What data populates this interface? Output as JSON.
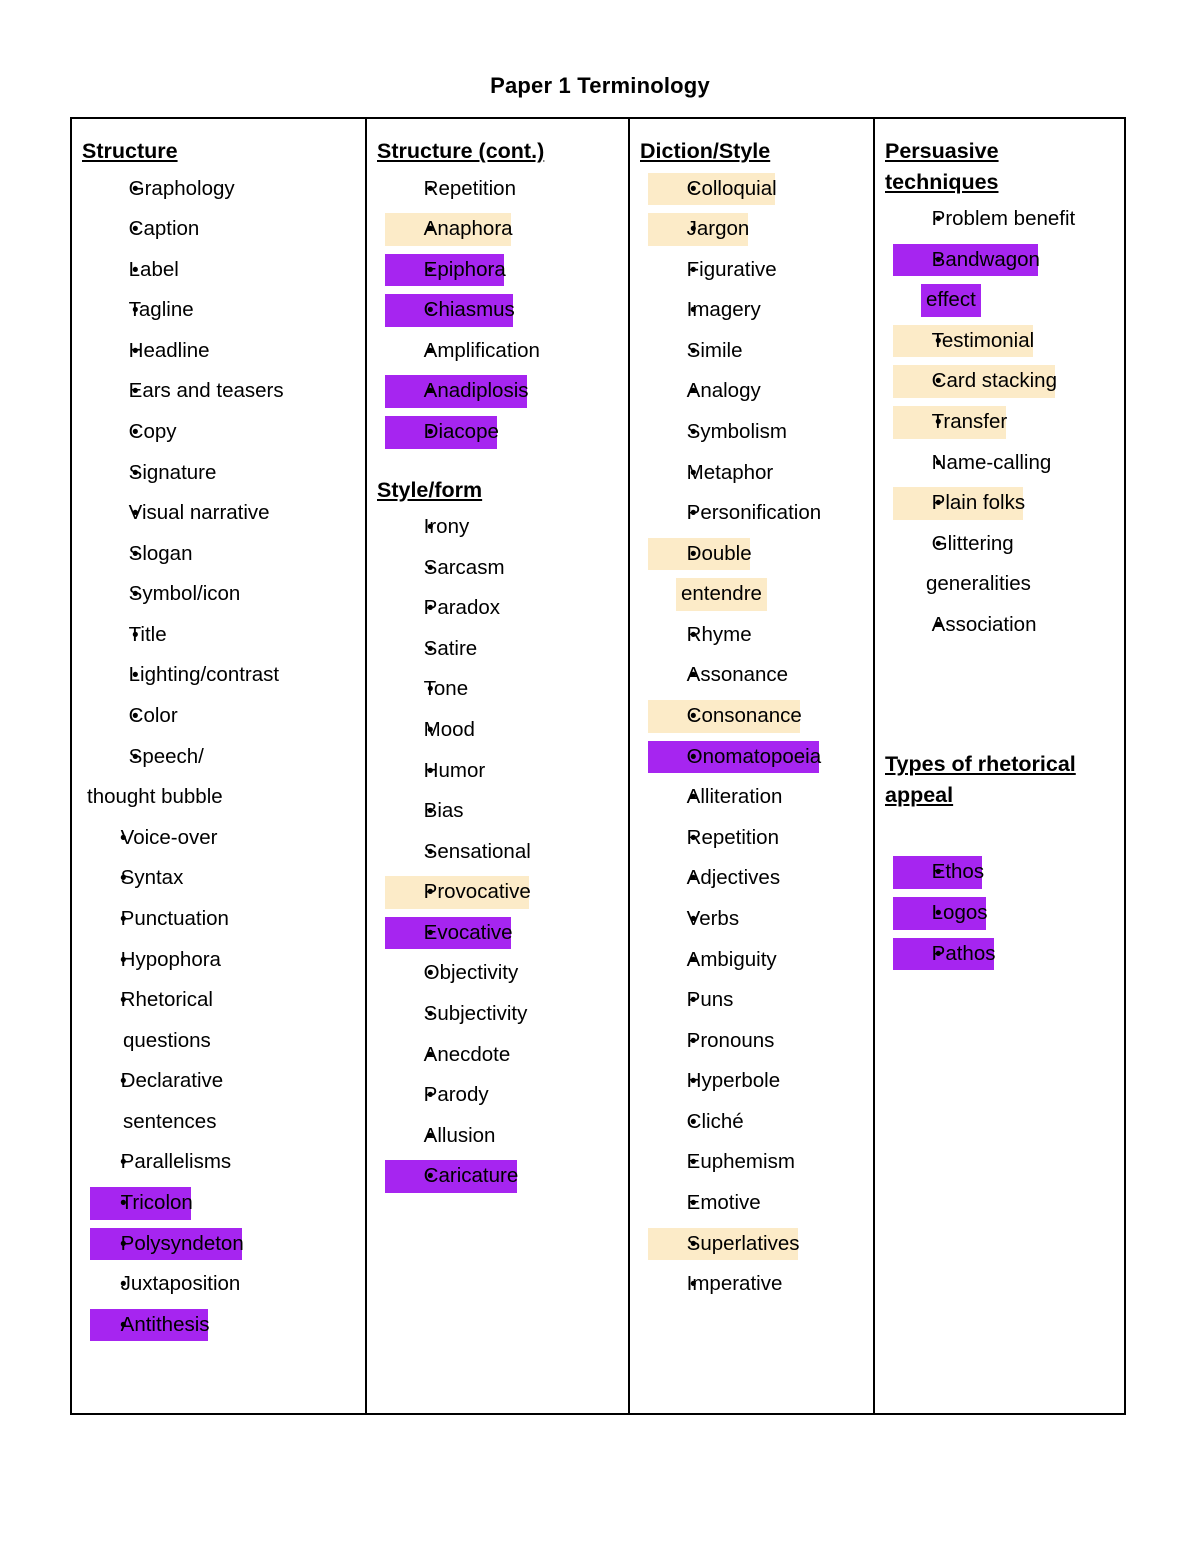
{
  "document": {
    "title": "Paper 1 Terminology",
    "highlight_colors": {
      "purple": "#a625f0",
      "cream": "#fcebc8",
      "none": "#ffffff"
    },
    "bullet_glyph": "•"
  },
  "columns": [
    {
      "id": "column-structure",
      "heading_lines": [
        "Structure"
      ],
      "items": [
        {
          "label": "Graphology",
          "highlight": "none"
        },
        {
          "label": "Caption",
          "highlight": "none"
        },
        {
          "label": "Label",
          "highlight": "none"
        },
        {
          "label": "Tagline",
          "highlight": "none"
        },
        {
          "label": "Headline",
          "highlight": "none"
        },
        {
          "label": "Ears and teasers",
          "highlight": "none"
        },
        {
          "label": "Copy",
          "highlight": "none"
        },
        {
          "label": "Signature",
          "highlight": "none"
        },
        {
          "label": "Visual narrative",
          "highlight": "none"
        },
        {
          "label": "Slogan",
          "highlight": "none"
        },
        {
          "label": "Symbol/icon",
          "highlight": "none"
        },
        {
          "label": "Title",
          "highlight": "none"
        },
        {
          "label": "Lighting/contrast",
          "highlight": "none"
        },
        {
          "label": "Color",
          "highlight": "none"
        },
        {
          "label": "Speech/",
          "highlight": "none",
          "continuation": "thought bubble",
          "continuation_style": "flush"
        },
        {
          "label": "Voice-over",
          "highlight": "none",
          "tight": true
        },
        {
          "label": "Syntax",
          "highlight": "none",
          "tight": true
        },
        {
          "label": "Punctuation",
          "highlight": "none",
          "tight": true
        },
        {
          "label": "Hypophora",
          "highlight": "none",
          "tight": true
        },
        {
          "label": "Rhetorical",
          "highlight": "none",
          "tight": true,
          "continuation": "questions",
          "continuation_style": "indent"
        },
        {
          "label": "Declarative",
          "highlight": "none",
          "tight": true,
          "continuation": "sentences",
          "continuation_style": "indent"
        },
        {
          "label": "Parallelisms",
          "highlight": "none",
          "tight": true
        },
        {
          "label": "Tricolon",
          "highlight": "purple",
          "tight": true
        },
        {
          "label": "Polysyndeton",
          "highlight": "purple",
          "tight": true
        },
        {
          "label": "Juxtaposition",
          "highlight": "none",
          "tight": true
        },
        {
          "label": "Antithesis",
          "highlight": "purple",
          "tight": true
        }
      ]
    },
    {
      "id": "column-structure-cont",
      "heading_lines": [
        "Structure (cont.)"
      ],
      "items": [
        {
          "label": "Repetition",
          "highlight": "none"
        },
        {
          "label": "Anaphora",
          "highlight": "cream"
        },
        {
          "label": "Epiphora",
          "highlight": "purple"
        },
        {
          "label": "Chiasmus",
          "highlight": "purple"
        },
        {
          "label": "Amplification",
          "highlight": "none"
        },
        {
          "label": "Anadiplosis",
          "highlight": "purple"
        },
        {
          "label": "Diacope",
          "highlight": "purple"
        }
      ],
      "subsections": [
        {
          "id": "subsection-style-form",
          "heading_lines": [
            "Style/form"
          ],
          "items": [
            {
              "label": "Irony",
              "highlight": "none"
            },
            {
              "label": "Sarcasm",
              "highlight": "none"
            },
            {
              "label": "Paradox",
              "highlight": "none"
            },
            {
              "label": "Satire",
              "highlight": "none"
            },
            {
              "label": "Tone",
              "highlight": "none"
            },
            {
              "label": "Mood",
              "highlight": "none"
            },
            {
              "label": "Humor",
              "highlight": "none"
            },
            {
              "label": "Bias",
              "highlight": "none"
            },
            {
              "label": "Sensational",
              "highlight": "none"
            },
            {
              "label": "Provocative",
              "highlight": "cream"
            },
            {
              "label": "Evocative",
              "highlight": "purple"
            },
            {
              "label": "Objectivity",
              "highlight": "none"
            },
            {
              "label": "Subjectivity",
              "highlight": "none"
            },
            {
              "label": "Anecdote",
              "highlight": "none"
            },
            {
              "label": "Parody",
              "highlight": "none"
            },
            {
              "label": "Allusion",
              "highlight": "none"
            },
            {
              "label": "Caricature",
              "highlight": "purple"
            }
          ]
        }
      ]
    },
    {
      "id": "column-diction-style",
      "heading_lines": [
        "Diction/Style"
      ],
      "items": [
        {
          "label": "Colloquial",
          "highlight": "cream"
        },
        {
          "label": "Jargon",
          "highlight": "cream"
        },
        {
          "label": "Figurative",
          "highlight": "none"
        },
        {
          "label": "Imagery",
          "highlight": "none"
        },
        {
          "label": "Simile",
          "highlight": "none"
        },
        {
          "label": "Analogy",
          "highlight": "none"
        },
        {
          "label": "Symbolism",
          "highlight": "none"
        },
        {
          "label": "Metaphor",
          "highlight": "none"
        },
        {
          "label": "Personification",
          "highlight": "none"
        },
        {
          "label": "Double",
          "highlight": "cream",
          "continuation": "entendre",
          "continuation_style": "indent"
        },
        {
          "label": "Rhyme",
          "highlight": "none"
        },
        {
          "label": "Assonance",
          "highlight": "none"
        },
        {
          "label": "Consonance",
          "highlight": "cream"
        },
        {
          "label": "Onomatopoeia",
          "highlight": "purple"
        },
        {
          "label": "Alliteration",
          "highlight": "none"
        },
        {
          "label": "Repetition",
          "highlight": "none"
        },
        {
          "label": "Adjectives",
          "highlight": "none"
        },
        {
          "label": "Verbs",
          "highlight": "none"
        },
        {
          "label": "Ambiguity",
          "highlight": "none"
        },
        {
          "label": "Puns",
          "highlight": "none"
        },
        {
          "label": "Pronouns",
          "highlight": "none"
        },
        {
          "label": "Hyperbole",
          "highlight": "none"
        },
        {
          "label": "Cliché",
          "highlight": "none"
        },
        {
          "label": "Euphemism",
          "highlight": "none"
        },
        {
          "label": "Emotive",
          "highlight": "none"
        },
        {
          "label": "Superlatives",
          "highlight": "cream"
        },
        {
          "label": "Imperative",
          "highlight": "none"
        }
      ]
    },
    {
      "id": "column-persuasive-techniques",
      "heading_lines": [
        "Persuasive",
        "techniques"
      ],
      "items": [
        {
          "label": "Problem benefit",
          "highlight": "none"
        },
        {
          "label": "Bandwagon",
          "highlight": "purple",
          "continuation": "effect",
          "continuation_style": "indent"
        },
        {
          "label": "Testimonial",
          "highlight": "cream"
        },
        {
          "label": "Card stacking",
          "highlight": "cream"
        },
        {
          "label": "Transfer",
          "highlight": "cream"
        },
        {
          "label": "Name-calling",
          "highlight": "none"
        },
        {
          "label": "Plain folks",
          "highlight": "cream"
        },
        {
          "label": "Glittering",
          "highlight": "none",
          "continuation": "generalities",
          "continuation_style": "indent"
        },
        {
          "label": "Association",
          "highlight": "none"
        }
      ],
      "subsections": [
        {
          "id": "subsection-rhetorical-appeal",
          "heading_lines": [
            "Types of rhetorical",
            "appeal"
          ],
          "items": [
            {
              "label": "Ethos",
              "highlight": "purple"
            },
            {
              "label": "Logos",
              "highlight": "purple"
            },
            {
              "label": "Pathos",
              "highlight": "purple"
            }
          ]
        }
      ]
    }
  ]
}
